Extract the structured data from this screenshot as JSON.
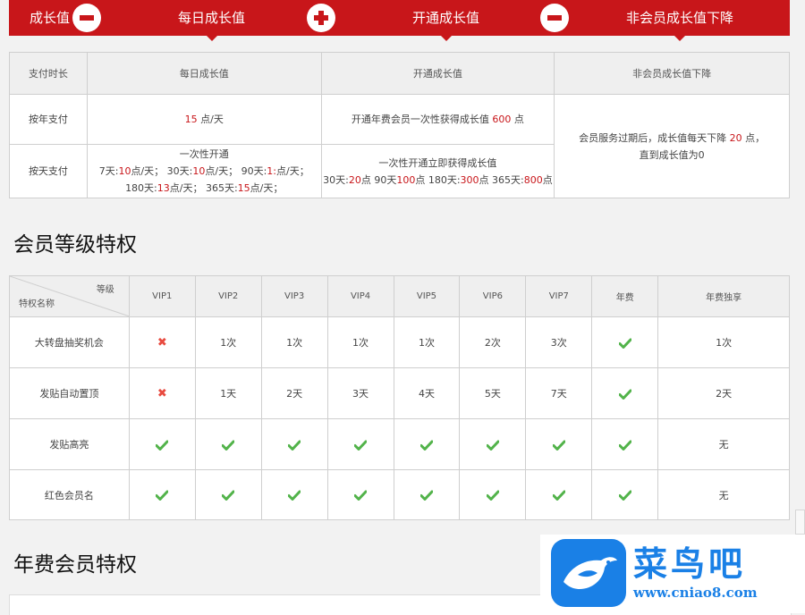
{
  "banner": {
    "growth_label": "成长值",
    "daily_label": "每日成长值",
    "open_label": "开通成长值",
    "decline_label": "非会员成长值下降",
    "ops": [
      "minus-icon",
      "plus-icon",
      "minus-icon"
    ],
    "bg_color": "#c8161a"
  },
  "growth_table": {
    "headers": [
      "支付时长",
      "每日成长值",
      "开通成长值",
      "非会员成长值下降"
    ],
    "rows": [
      {
        "label": "按年支付",
        "daily_value": "15",
        "daily_unit": "点/天",
        "open_prefix": "开通年费会员一次性获得成长值",
        "open_value": "600",
        "open_unit": "点"
      },
      {
        "label": "按天支付",
        "daily_title": "一次性开通",
        "daily_line1": [
          {
            "k": "7天:",
            "v": "10",
            "u": "点/天；"
          },
          {
            "k": "30天:",
            "v": "10",
            "u": "点/天；"
          },
          {
            "k": "90天:",
            "v": "1:",
            "u": "点/天；"
          }
        ],
        "daily_line2": [
          {
            "k": "180天:",
            "v": "13",
            "u": "点/天；"
          },
          {
            "k": "365天:",
            "v": "15",
            "u": "点/天；"
          }
        ],
        "open_title": "一次性开通立即获得成长值",
        "open_line": [
          {
            "k": "30天:",
            "v": "20",
            "u": "点"
          },
          {
            "k": "90天",
            "v": "100",
            "u": "点"
          },
          {
            "k": "180天:",
            "v": "300",
            "u": "点"
          },
          {
            "k": "365天:",
            "v": "800",
            "u": "点"
          }
        ]
      }
    ],
    "decline_prefix": "会员服务过期后，成长值每天下降",
    "decline_value": "20",
    "decline_unit": "点，",
    "decline_line2": "直到成长值为0"
  },
  "privilege_section": {
    "title": "会员等级特权",
    "corner_level": "等级",
    "corner_name": "特权名称",
    "columns": [
      "VIP1",
      "VIP2",
      "VIP3",
      "VIP4",
      "VIP5",
      "VIP6",
      "VIP7",
      "年费",
      "年费独享"
    ],
    "rows": [
      {
        "name": "大转盘抽奖机会",
        "cells": [
          "x",
          "1次",
          "1次",
          "1次",
          "1次",
          "2次",
          "3次",
          "check",
          "1次"
        ]
      },
      {
        "name": "发贴自动置顶",
        "cells": [
          "x",
          "1天",
          "2天",
          "3天",
          "4天",
          "5天",
          "7天",
          "check",
          "2天"
        ]
      },
      {
        "name": "发贴高亮",
        "cells": [
          "check",
          "check",
          "check",
          "check",
          "check",
          "check",
          "check",
          "check",
          "无"
        ]
      },
      {
        "name": "红色会员名",
        "cells": [
          "check",
          "check",
          "check",
          "check",
          "check",
          "check",
          "check",
          "check",
          "无"
        ]
      }
    ]
  },
  "annual_section": {
    "title": "年费会员特权"
  },
  "logo": {
    "name": "菜鸟吧",
    "url": "www.cniao8.com",
    "color": "#1a80e6"
  }
}
